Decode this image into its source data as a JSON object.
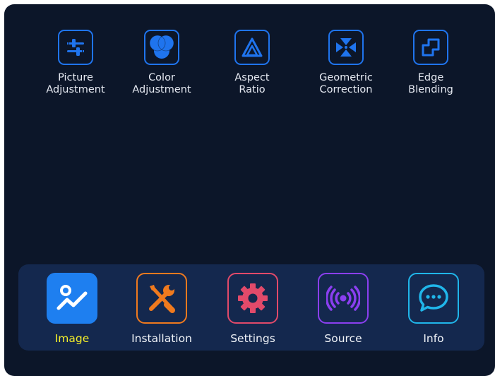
{
  "submenu": [
    {
      "label": "Picture\nAdjustment",
      "icon": "sliders-icon"
    },
    {
      "label": "Color\nAdjustment",
      "icon": "color-circles-icon"
    },
    {
      "label": "Aspect\nRatio",
      "icon": "aspect-triangle-icon"
    },
    {
      "label": "Geometric\nCorrection",
      "icon": "geometric-arrows-icon"
    },
    {
      "label": "Edge\nBlending",
      "icon": "edge-blend-icon"
    }
  ],
  "dock": [
    {
      "label": "Image",
      "icon": "image-chart-icon",
      "active": true
    },
    {
      "label": "Installation",
      "icon": "wrench-screwdriver-icon",
      "active": false
    },
    {
      "label": "Settings",
      "icon": "gear-icon",
      "active": false
    },
    {
      "label": "Source",
      "icon": "signal-broadcast-icon",
      "active": false
    },
    {
      "label": "Info",
      "icon": "chat-bubble-icon",
      "active": false
    }
  ],
  "colors": {
    "background": "#0c1629",
    "dock_background": "#14284e",
    "submenu_accent": "#1f74ee",
    "active_label": "#f5ef2a",
    "image_tile": "#1e7ff0",
    "installation_accent": "#f07a1e",
    "settings_accent": "#e24a6a",
    "source_accent": "#8b3ff0",
    "info_accent": "#20b6ea"
  }
}
